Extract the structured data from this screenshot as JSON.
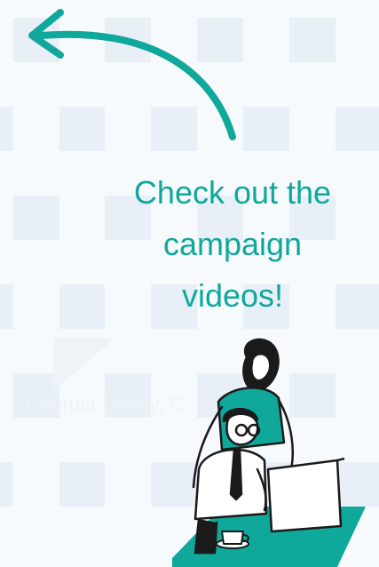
{
  "callout": {
    "line1": "Check out the",
    "line2": "campaign",
    "line3": "videos!"
  },
  "faded_caption": "Georgia Lewey, C",
  "colors": {
    "accent": "#0fa89a",
    "background": "#f7fafc",
    "grid_tile": "#e8eff6",
    "ink": "#1a1a1a"
  },
  "icons": {
    "arrow": "curved-arrow-icon",
    "illustration": "people-at-laptop-illustration"
  }
}
